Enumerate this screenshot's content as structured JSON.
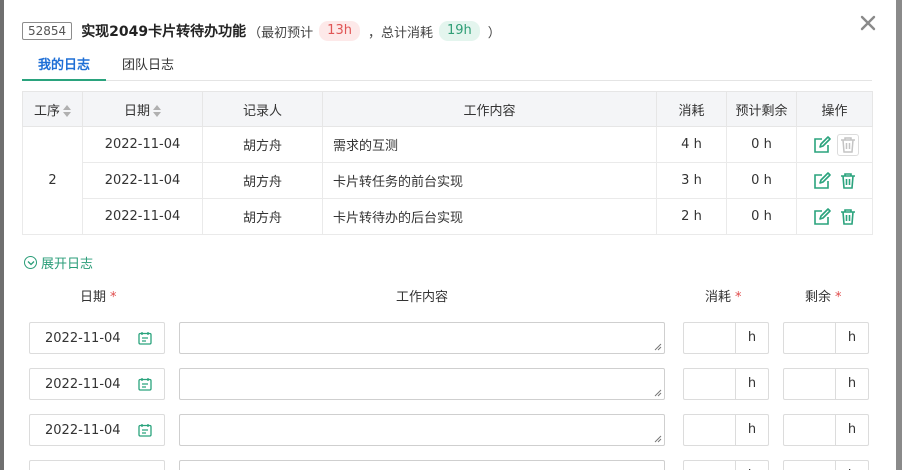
{
  "header": {
    "task_id": "52854",
    "title": "实现2049卡片转待办功能",
    "meta_open": "（最初预计",
    "estimate": "13h",
    "meta_mid": "，总计消耗",
    "consumed": "19h",
    "meta_close": "）"
  },
  "tabs": [
    {
      "label": "我的日志",
      "active": true
    },
    {
      "label": "团队日志",
      "active": false
    }
  ],
  "table": {
    "columns": [
      "工序",
      "日期",
      "记录人",
      "工作内容",
      "消耗",
      "预计剩余",
      "操作"
    ],
    "group_step": "2",
    "rows": [
      {
        "date": "2022-11-04",
        "recorder": "胡方舟",
        "content": "需求的互测",
        "consumed": "4 h",
        "remaining": "0 h"
      },
      {
        "date": "2022-11-04",
        "recorder": "胡方舟",
        "content": "卡片转任务的前台实现",
        "consumed": "3 h",
        "remaining": "0 h"
      },
      {
        "date": "2022-11-04",
        "recorder": "胡方舟",
        "content": "卡片转待办的后台实现",
        "consumed": "2 h",
        "remaining": "0 h"
      }
    ]
  },
  "expand_label": "展开日志",
  "form": {
    "date_label": "日期",
    "content_label": "工作内容",
    "consumed_label": "消耗",
    "remaining_label": "剩余",
    "required_mark": "*",
    "unit": "h",
    "rows": [
      {
        "date": "2022-11-04"
      },
      {
        "date": "2022-11-04"
      },
      {
        "date": "2022-11-04"
      },
      {
        "date": ""
      }
    ]
  },
  "colors": {
    "accent": "#2aa37d",
    "tab_active": "#1f6fd6",
    "danger": "#e04b4b"
  },
  "icons": {
    "close": "close-icon",
    "edit": "edit-icon",
    "delete": "trash-icon",
    "calendar": "calendar-icon",
    "expand": "chevron-down-icon",
    "sort": "sort-icon"
  }
}
